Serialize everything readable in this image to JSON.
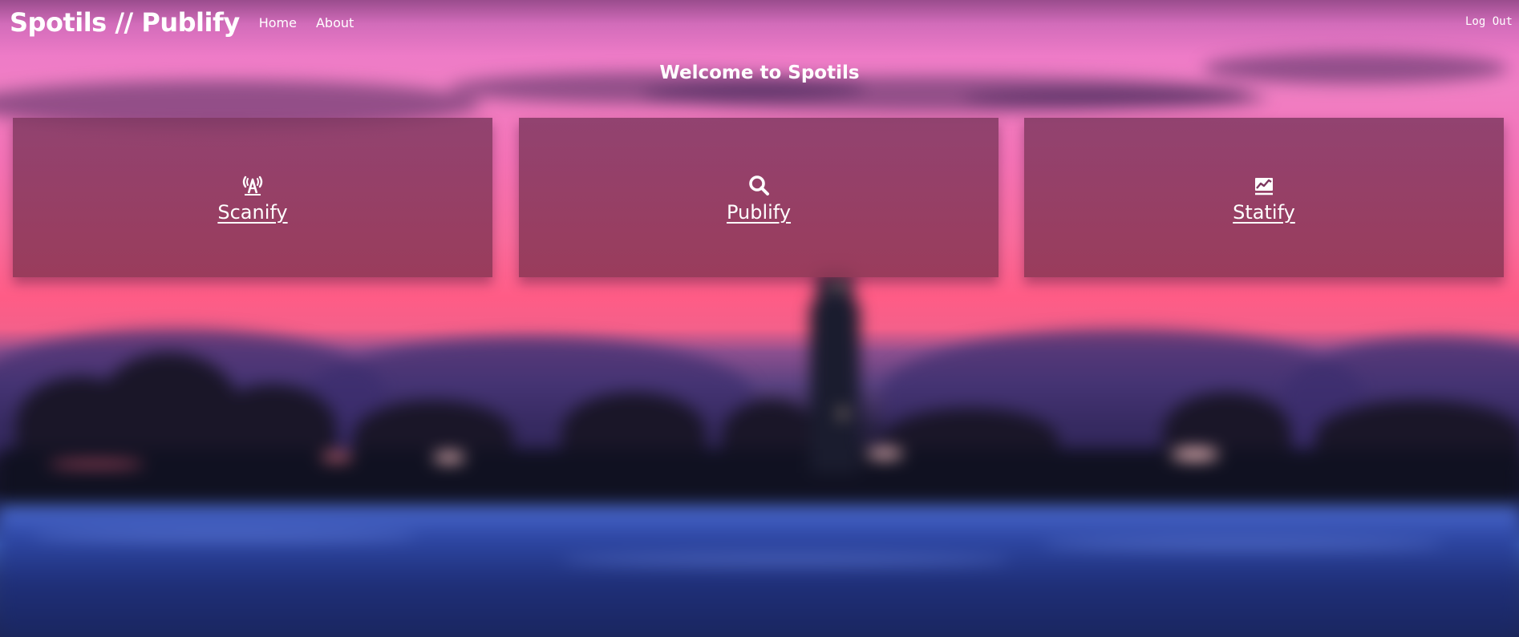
{
  "header": {
    "brand": "Spotils // Publify",
    "nav": [
      {
        "label": "Home"
      },
      {
        "label": "About"
      }
    ],
    "logout_label": "Log Out"
  },
  "main": {
    "welcome": "Welcome to Spotils",
    "cards": [
      {
        "label": "Scanify",
        "icon": "broadcast-tower-icon"
      },
      {
        "label": "Publify",
        "icon": "search-icon"
      },
      {
        "label": "Statify",
        "icon": "chart-line-icon"
      }
    ]
  },
  "colors": {
    "card_overlay": "#7d375f",
    "sky_pink": "#f07fc4",
    "sunset_red": "#ff5c86",
    "water_blue": "#2e47a4"
  }
}
